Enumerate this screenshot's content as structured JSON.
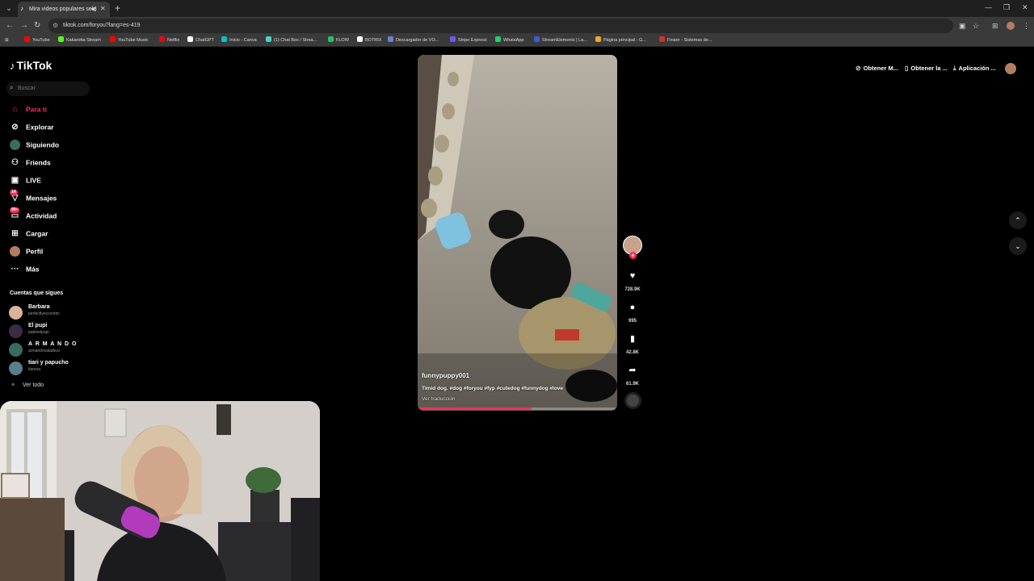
{
  "browser": {
    "tab_title": "Mira videos populares sele",
    "url": "tiktok.com/foryou?lang=es-419",
    "bookmarks": [
      {
        "label": "YouTube",
        "color": "#ff0000"
      },
      {
        "label": "Kakarotta Stream",
        "color": "#53fc18"
      },
      {
        "label": "YouTube Music",
        "color": "#ff0000"
      },
      {
        "label": "Netflix",
        "color": "#e50914"
      },
      {
        "label": "ChatGPT",
        "color": "#ffffff"
      },
      {
        "label": "Inicio - Canva",
        "color": "#00c4cc"
      },
      {
        "label": "(1) Chat Box / Strea...",
        "color": "#4fd1c5"
      },
      {
        "label": "FLOW",
        "color": "#22c55e"
      },
      {
        "label": "BOTRIX",
        "color": "#ffffff"
      },
      {
        "label": "Descargador de VO...",
        "color": "#6b7fd7"
      },
      {
        "label": "Stripe Express",
        "color": "#635bff"
      },
      {
        "label": "WhatsApp",
        "color": "#25d366"
      },
      {
        "label": "StreamElements | La...",
        "color": "#3b5bdb"
      },
      {
        "label": "Página principal - G...",
        "color": "#f5a623"
      },
      {
        "label": "Finaer - Sistemas de...",
        "color": "#d32f2f"
      }
    ]
  },
  "tiktok": {
    "logo": "TikTok",
    "search_placeholder": "Buscar",
    "nav": [
      {
        "label": "Para ti",
        "icon": "home-icon"
      },
      {
        "label": "Explorar",
        "icon": "compass-icon"
      },
      {
        "label": "Siguiendo",
        "icon": "following-icon"
      },
      {
        "label": "Friends",
        "icon": "friends-icon"
      },
      {
        "label": "LIVE",
        "icon": "live-icon"
      },
      {
        "label": "Mensajes",
        "icon": "messages-icon",
        "badge": "14"
      },
      {
        "label": "Actividad",
        "icon": "activity-icon",
        "badge": "99+"
      },
      {
        "label": "Cargar",
        "icon": "upload-icon"
      },
      {
        "label": "Perfil",
        "icon": "profile-icon"
      },
      {
        "label": "Más",
        "icon": "more-icon"
      }
    ],
    "following_title": "Cuentas que sigues",
    "following": [
      {
        "name": "Barbara",
        "handle": "perfectlyeccentric"
      },
      {
        "name": "El pupi",
        "handle": "pabloelpupi"
      },
      {
        "name": "A R M A N D O",
        "handle": "armandovaladezz"
      },
      {
        "name": "tiari y papucho",
        "handle": "tiarisss"
      }
    ],
    "see_all": "Ver todo",
    "top_right": {
      "btn1": "Obtener M...",
      "btn2": "Obtener la ...",
      "btn3": "Aplicación ..."
    },
    "video": {
      "author": "funnypuppy001",
      "description": "Timid dog. #dog #foryou #fyp #cutedog #funnydog #love",
      "translate": "Ver traducción",
      "progress": 0.57,
      "likes": "728.9K",
      "comments": "995",
      "saves": "42.8K",
      "shares": "61.9K"
    }
  }
}
